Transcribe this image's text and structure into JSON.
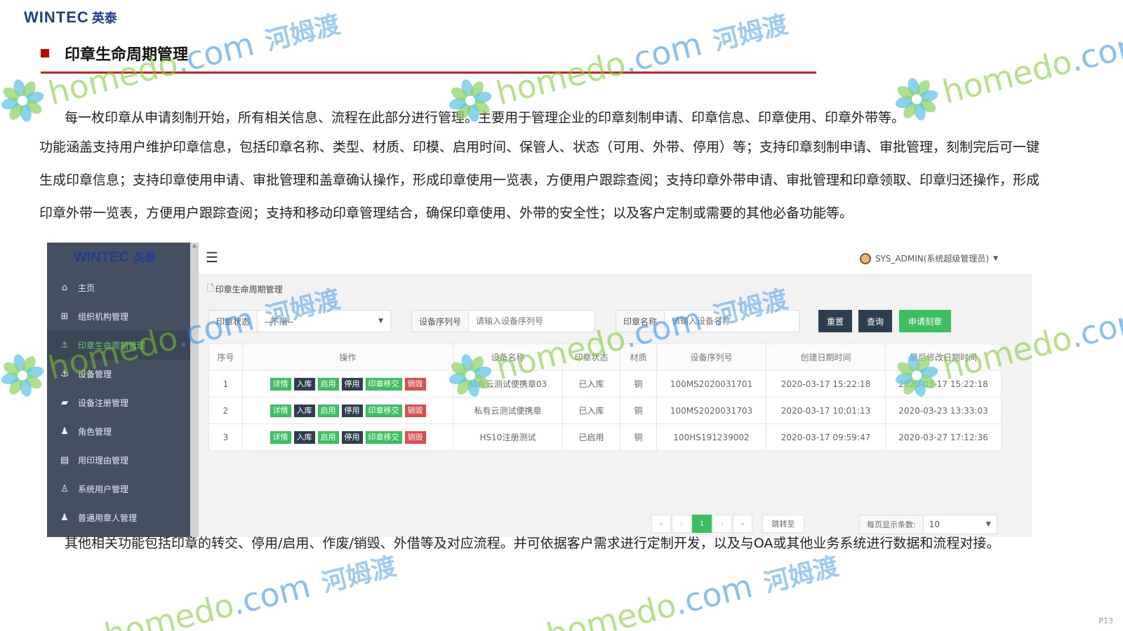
{
  "brand": {
    "name_en": "WINTEC",
    "name_cn": "英泰"
  },
  "slide": {
    "title": "印章生命周期管理",
    "paragraph_1": "每一枚印章从申请刻制开始，所有相关信息、流程在此部分进行管理。主要用于管理企业的印章刻制申请、印章信息、印章使用、印章外带等。",
    "paragraph_2": "功能涵盖支持用户维护印章信息，包括印章名称、类型、材质、印模、启用时间、保管人、状态（可用、外带、停用）等；支持印章刻制申请、审批管理，刻制完后可一键生成印章信息；支持印章使用申请、审批管理和盖章确认操作，形成印章使用一览表，方便用户跟踪查阅；支持印章外带申请、审批管理和印章领取、印章归还操作，形成印章外带一览表，方便用户跟踪查阅；支持和移动印章管理结合，确保印章使用、外带的安全性；以及客户定制或需要的其他必备功能等。",
    "paragraph_3": "其他相关功能包括印章的转交、停用/启用、作废/销毁、外借等及对应流程。并可依据客户需求进行定制开发，以及与OA或其他业务系统进行数据和流程对接。",
    "page_number": "P13"
  },
  "app": {
    "sidebar": {
      "logo_en": "WINTEC",
      "logo_cn": "英泰",
      "items": [
        {
          "label": "主页",
          "icon": "home-icon"
        },
        {
          "label": "组织机构管理",
          "icon": "org-chart-icon"
        },
        {
          "label": "印章生命周期管理",
          "icon": "anchor-icon",
          "active": true
        },
        {
          "label": "设备管理",
          "icon": "anchor-icon"
        },
        {
          "label": "设备注册管理",
          "icon": "book-icon"
        },
        {
          "label": "角色管理",
          "icon": "user-group-icon"
        },
        {
          "label": "用印理由管理",
          "icon": "file-icon"
        },
        {
          "label": "系统用户管理",
          "icon": "person-icon"
        },
        {
          "label": "普通用章人管理",
          "icon": "user-icon"
        }
      ]
    },
    "topbar": {
      "user": "SYS_ADMIN(系统超级管理员)"
    },
    "breadcrumb": "印章生命周期管理",
    "filters": {
      "status_label": "印章状态",
      "status_value": "--不限--",
      "serial_label": "设备序列号",
      "serial_placeholder": "请输入设备序列号",
      "name_label": "印章名称",
      "name_placeholder": "请输入设备名称",
      "reset": "重置",
      "query": "查询",
      "apply": "申请刻章"
    },
    "table": {
      "columns": [
        "序号",
        "操作",
        "设备名称",
        "印章状态",
        "材质",
        "设备序列号",
        "创建日期时间",
        "最后修改日期时间"
      ],
      "actions": [
        "详情",
        "入库",
        "启用",
        "停用",
        "印章移交",
        "销毁"
      ],
      "rows": [
        {
          "no": "1",
          "name": "私有云测试便携章03",
          "status": "已入库",
          "material": "铜",
          "serial": "100MS2020031701",
          "created": "2020-03-17 15:22:18",
          "modified": "2020-03-17 15:22:18"
        },
        {
          "no": "2",
          "name": "私有云测试便携章",
          "status": "已入库",
          "material": "铜",
          "serial": "100MS2020031703",
          "created": "2020-03-17 10:01:13",
          "modified": "2020-03-23 13:33:03"
        },
        {
          "no": "3",
          "name": "HS10注册测试",
          "status": "已启用",
          "material": "铜",
          "serial": "100HS191239002",
          "created": "2020-03-17 09:59:47",
          "modified": "2020-03-27 17:12:36"
        }
      ]
    },
    "pager": {
      "first": "«",
      "prev": "‹",
      "current": "1",
      "next": "›",
      "last": "»",
      "jump": "跳转至",
      "per_page_label": "每页显示条数:",
      "per_page_value": "10"
    }
  },
  "watermark": {
    "text": "homedo",
    "suffix": ".com",
    "cn": "河姆渡"
  },
  "colors": {
    "accent_red": "#d21f1f",
    "brand_blue": "#1e3f8f",
    "sidebar": "#445062",
    "btn_green": "#3cbf5f",
    "btn_dark": "#2c3e50",
    "btn_red": "#e04b4b"
  }
}
